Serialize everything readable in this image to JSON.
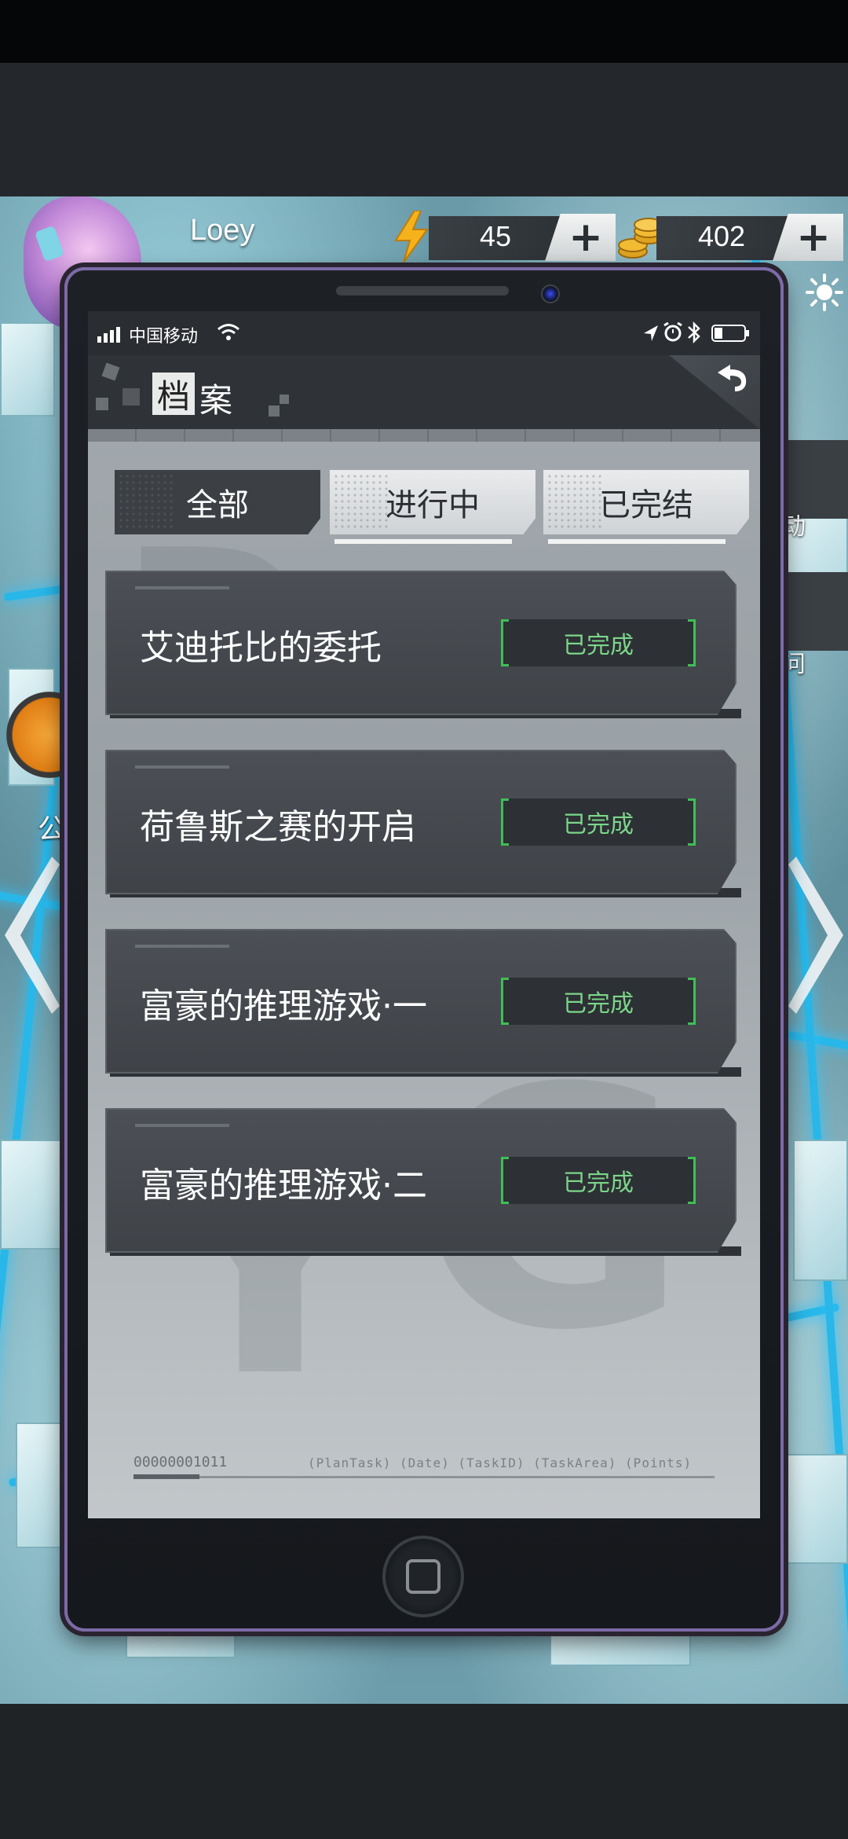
{
  "hud": {
    "username": "Loey",
    "energy_value": "45",
    "coins_value": "402",
    "energy_icon": "lightning-bolt-icon",
    "coin_icon": "coin-stack-icon",
    "plus_label": "+"
  },
  "side": {
    "left_label": "公",
    "right_top_label": "动",
    "right_bottom_label": "问"
  },
  "phone": {
    "status": {
      "carrier": "中国移动"
    },
    "header": {
      "title_first_char": "档",
      "title_rest": "案"
    },
    "tabs": [
      {
        "label": "全部",
        "active": true
      },
      {
        "label": "进行中",
        "active": false
      },
      {
        "label": "已完结",
        "active": false
      }
    ],
    "missions": [
      {
        "title": "艾迪托比的委托",
        "status": "已完成"
      },
      {
        "title": "荷鲁斯之赛的开启",
        "status": "已完成"
      },
      {
        "title": "富豪的推理游戏·一",
        "status": "已完成"
      },
      {
        "title": "富豪的推理游戏·二",
        "status": "已完成"
      }
    ],
    "footer": {
      "code": "00000001011",
      "fields": "(PlanTask) (Date) (TaskID) (TaskArea) (Points)"
    }
  },
  "colors": {
    "status_green": "#7bd68a",
    "phone_frame": "#7c6aa8",
    "road_blue": "#28b7e8"
  }
}
